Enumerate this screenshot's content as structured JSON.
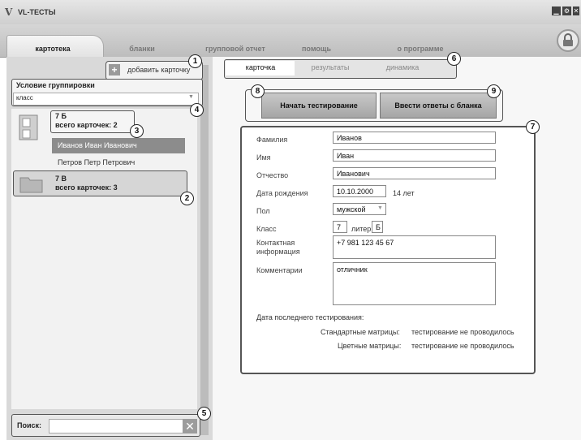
{
  "app": {
    "logo": "V",
    "title": "VL-ТЕСТЫ",
    "minimize": "▁",
    "settings": "⚙",
    "close": "✕"
  },
  "menu": {
    "tabs": [
      "картотека",
      "бланки",
      "групповой отчет",
      "помощь",
      "о программе"
    ],
    "active": "картотека"
  },
  "left": {
    "add_card": "добавить карточку",
    "grouping": {
      "title": "Условие группировки",
      "value": "класс"
    },
    "groups": [
      {
        "title": "7 Б",
        "count": "всего карточек: 2",
        "people": [
          "Иванов Иван Иванович",
          "Петров Петр Петрович"
        ]
      },
      {
        "title": "7 В",
        "count": "всего карточек: 3"
      }
    ],
    "search": {
      "label": "Поиск:",
      "value": ""
    }
  },
  "right": {
    "subtabs": [
      "карточка",
      "результаты",
      "динамика"
    ],
    "buttons": {
      "start": "Начать тестирование",
      "enter": "Ввести ответы с бланка"
    },
    "form": {
      "surname": {
        "label": "Фамилия",
        "value": "Иванов"
      },
      "name": {
        "label": "Имя",
        "value": "Иван"
      },
      "patronymic": {
        "label": "Отчество",
        "value": "Иванович"
      },
      "birth": {
        "label": "Дата рождения",
        "value": "10.10.2000",
        "age": "14 лет"
      },
      "gender": {
        "label": "Пол",
        "value": "мужской"
      },
      "class": {
        "label": "Класс",
        "value": "7",
        "letter_label": "литер",
        "letter": "Б"
      },
      "contact": {
        "label": "Контактная информация",
        "value": "+7 981 123 45 67"
      },
      "comment": {
        "label": "Комментарии",
        "value": "отличник"
      },
      "last_test": {
        "title": "Дата последнего тестирования:",
        "standard_label": "Стандартные матрицы:",
        "standard_value": "тестирование не проводилось",
        "color_label": "Цветные матрицы:",
        "color_value": "тестирование не проводилось"
      }
    }
  },
  "callouts": [
    "1",
    "2",
    "3",
    "4",
    "5",
    "6",
    "7",
    "8",
    "9"
  ]
}
